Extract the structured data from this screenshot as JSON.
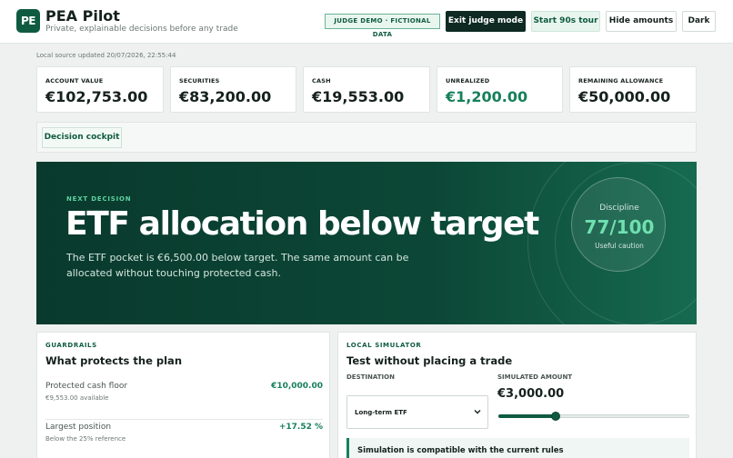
{
  "app": {
    "logo_text": "PE",
    "title": "PEA Pilot",
    "subtitle": "Private, explainable decisions before any trade"
  },
  "header": {
    "demo_badge": "JUDGE DEMO · FICTIONAL DATA",
    "exit_judge_label": "Exit judge mode",
    "tour_label": "Start 90s tour",
    "hide_amounts_label": "Hide amounts",
    "dark_label": "Dark"
  },
  "updated_text": "Local source updated 20/07/2026, 22:55:44",
  "metrics": [
    {
      "label": "ACCOUNT VALUE",
      "value": "€102,753.00"
    },
    {
      "label": "SECURITIES",
      "value": "€83,200.00"
    },
    {
      "label": "CASH",
      "value": "€19,553.00"
    },
    {
      "label": "UNREALIZED",
      "value": "€1,200.00"
    },
    {
      "label": "REMAINING ALLOWANCE",
      "value": "€50,000.00"
    }
  ],
  "tabs": [
    {
      "label": "Decision cockpit"
    }
  ],
  "hero": {
    "kicker": "NEXT DECISION",
    "title": "ETF allocation below target",
    "text": "The ETF pocket is €6,500.00 below target. The same amount can be allocated without touching protected cash.",
    "gauge_label": "Discipline",
    "gauge_score": "77/100",
    "gauge_sub": "Useful caution"
  },
  "guardrails": {
    "kicker": "GUARDRAILS",
    "title": "What protects the plan",
    "rows": [
      {
        "label": "Protected cash floor",
        "sub": "€9,553.00 available",
        "value": "€10,000.00"
      },
      {
        "label": "Largest position",
        "sub": "Below the 25% reference",
        "value": "+17.52 %"
      }
    ]
  },
  "simulator": {
    "kicker": "LOCAL SIMULATOR",
    "title": "Test without placing a trade",
    "destination_label": "DESTINATION",
    "destination_value": "Long-term ETF",
    "amount_label": "SIMULATED AMOUNT",
    "amount_value": "€3,000.00",
    "slider_fraction": 0.3,
    "notice": "Simulation is compatible with the current rules"
  },
  "colors": {
    "brand": "#0f5b42",
    "positive": "#16805a",
    "hero_bg": "#0c4736"
  }
}
